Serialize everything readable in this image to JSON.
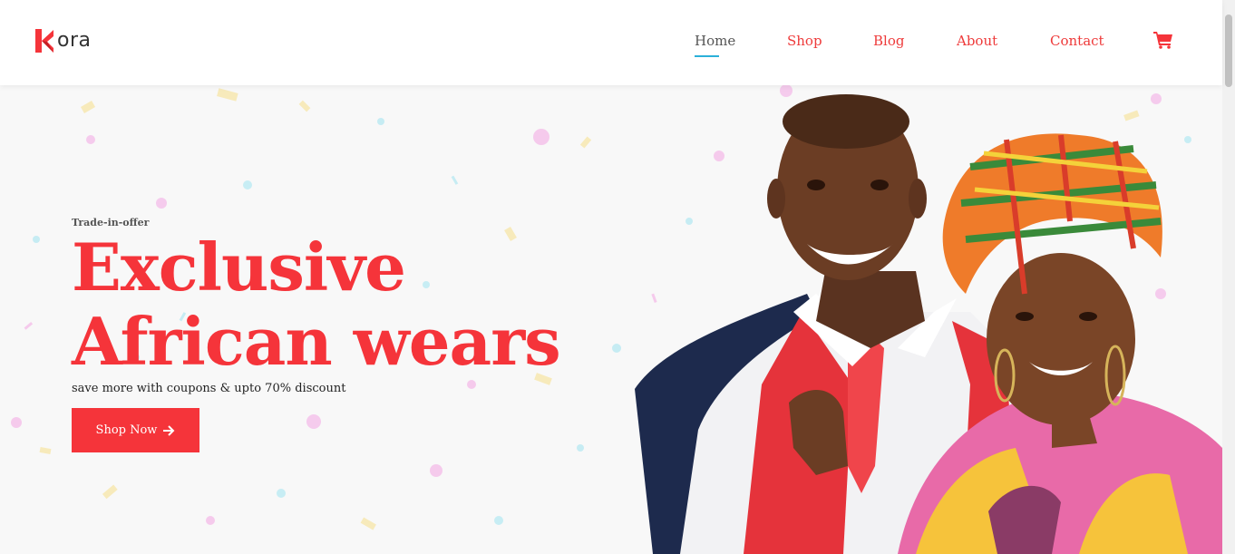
{
  "header": {
    "logo_text": "ora",
    "nav": [
      {
        "label": "Home"
      },
      {
        "label": "Shop"
      },
      {
        "label": "Blog"
      },
      {
        "label": "About"
      },
      {
        "label": "Contact"
      }
    ],
    "active_nav": "Home",
    "cart_icon": "shopping-cart-icon"
  },
  "hero": {
    "tagline": "Trade-in-offer",
    "headline_line1": "Exclusive",
    "headline_line2": "African wears",
    "subtext": "save more with coupons & upto 70% discount",
    "button_label": "Shop Now",
    "button_icon": "arrow-right-icon",
    "image_description": "smiling man in red vest and woman in kente headwrap"
  },
  "colors": {
    "accent": "#f5343a",
    "nav_active": "#555555",
    "nav_underline": "#2bb0d9",
    "hero_bg": "#f8f8f8"
  }
}
